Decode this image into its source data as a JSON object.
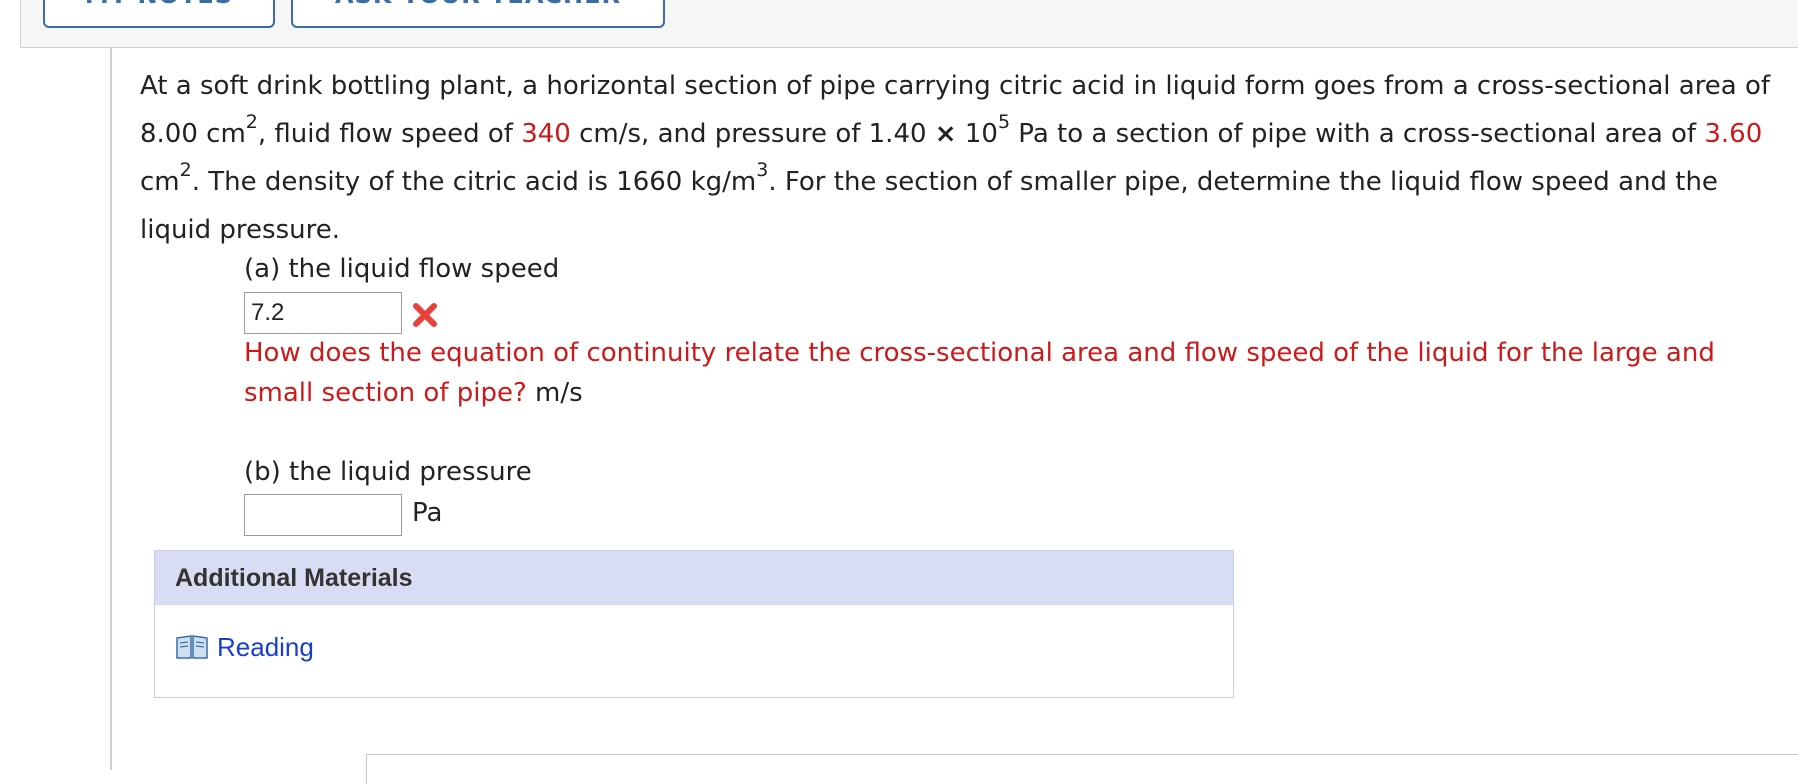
{
  "top_buttons": [
    {
      "label": "MY NOTES"
    },
    {
      "label": "ASK YOUR TEACHER"
    }
  ],
  "question": {
    "t1": "At a soft drink bottling plant, a horizontal section of pipe carrying citric acid in liquid form goes from a cross-sectional area of 8.00 cm",
    "sup1": "2",
    "t2": ", fluid flow speed of ",
    "speed": "340",
    "t3": " cm/s, and pressure of 1.40 ",
    "times": "×",
    "t4": " 10",
    "sup2": "5",
    "t5": " Pa to a section of pipe with a cross-sectional area of ",
    "area2": "3.60",
    "t6": " cm",
    "sup3": "2",
    "t7": ". The density of the citric acid is 1660 kg/m",
    "sup4": "3",
    "t8": ". For the section of smaller pipe, determine the liquid flow speed and the liquid pressure."
  },
  "part_a": {
    "label": "(a) the liquid flow speed",
    "value": "7.2",
    "feedback": "How does the equation of continuity relate the cross-sectional area and flow speed of the liquid for the large and small section of pipe?",
    "unit": "m/s"
  },
  "part_b": {
    "label": "(b) the liquid pressure",
    "value": "",
    "unit": "Pa"
  },
  "materials": {
    "title": "Additional Materials",
    "link": "Reading"
  },
  "colors": {
    "accent_red": "#cc1a1a",
    "link_blue": "#1a3ecc",
    "materials_header": "#d9ddf3"
  }
}
